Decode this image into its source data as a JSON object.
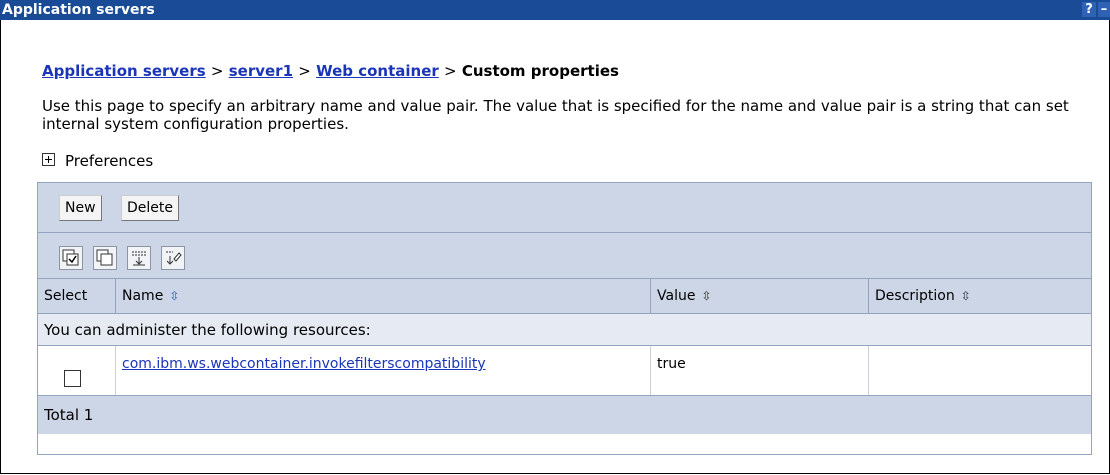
{
  "window": {
    "title": "Application servers",
    "help_glyph": "?",
    "minimize_glyph": "–"
  },
  "breadcrumb": {
    "items": [
      "Application servers",
      "server1",
      "Web container"
    ],
    "separator": ">",
    "current": "Custom properties"
  },
  "description": "Use this page to specify an arbitrary name and value pair. The value that is specified for the name and value pair is a string that can set internal system configuration properties.",
  "preferences": {
    "label": "Preferences",
    "icon": "plus-expand-icon"
  },
  "toolbar": {
    "new_label": "New",
    "delete_label": "Delete"
  },
  "icon_toolbar": [
    "select-all-icon",
    "deselect-all-icon",
    "show-filter-icon",
    "clear-filter-icon"
  ],
  "table": {
    "columns": [
      "Select",
      "Name",
      "Value",
      "Description"
    ],
    "note": "You can administer the following resources:",
    "rows": [
      {
        "name": "com.ibm.ws.webcontainer.invokefilterscompatibility",
        "value": "true",
        "description": ""
      }
    ],
    "total": "Total 1"
  },
  "colors": {
    "title_bar": "#1a4b97",
    "panel_bg": "#cdd6e6",
    "link": "#1a35b8"
  }
}
